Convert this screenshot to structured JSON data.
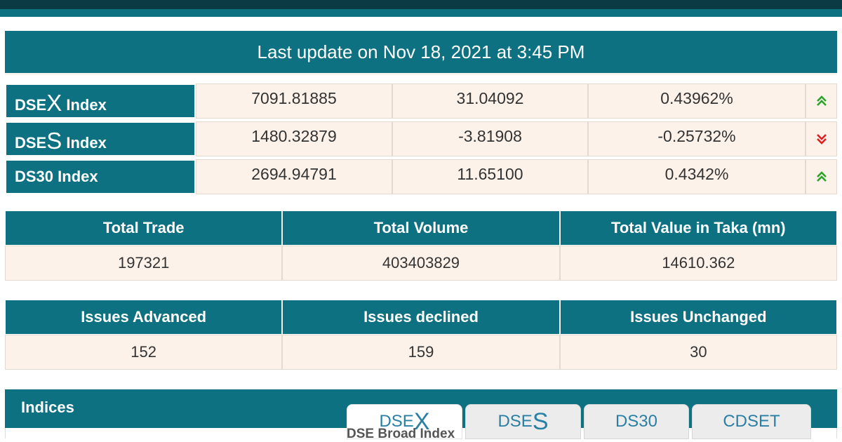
{
  "update": {
    "text": "Last update on Nov 18, 2021 at 3:45 PM"
  },
  "indices": [
    {
      "prefix": "DSE",
      "letter": "X",
      "suffix": " Index",
      "value": "7091.81885",
      "change": "31.04092",
      "percent": "0.43962%",
      "direction": "up"
    },
    {
      "prefix": "DSE",
      "letter": "S",
      "suffix": " Index",
      "value": "1480.32879",
      "change": "-3.81908",
      "percent": "-0.25732%",
      "direction": "down"
    },
    {
      "label": "DS30 Index",
      "value": "2694.94791",
      "change": "11.65100",
      "percent": "0.4342%",
      "direction": "up"
    }
  ],
  "trade": {
    "headers": [
      "Total Trade",
      "Total Volume",
      "Total Value in Taka (mn)"
    ],
    "values": [
      "197321",
      "403403829",
      "14610.362"
    ]
  },
  "issues": {
    "headers": [
      "Issues Advanced",
      "Issues declined",
      "Issues Unchanged"
    ],
    "values": [
      "152",
      "159",
      "30"
    ]
  },
  "indices_panel": {
    "title": "Indices",
    "tabs": [
      {
        "prefix": "DSE",
        "letter": "X"
      },
      {
        "prefix": "DSE",
        "letter": "S"
      },
      {
        "label": "DS30"
      },
      {
        "label": "CDSET"
      }
    ],
    "subtitle": "DSE Broad Index"
  },
  "colors": {
    "header_bg": "#0d7181",
    "cell_bg": "#fdf2ea",
    "up": "#2aa52a",
    "down": "#e02020",
    "tab_text": "#2a7fa5"
  }
}
